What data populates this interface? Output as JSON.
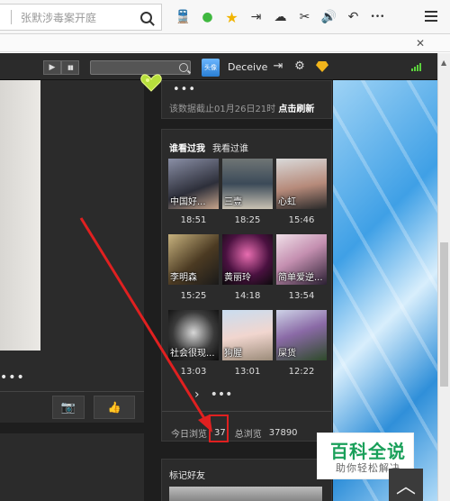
{
  "browser": {
    "search_text": "张默涉毒案开庭",
    "icons": [
      "search-icon",
      "train-icon",
      "chat-icon",
      "star-icon",
      "exit-icon",
      "cloud-icon",
      "scissors-icon",
      "speaker-icon",
      "undo-icon",
      "more-icon",
      "menu-icon"
    ],
    "icon_glyphs": [
      "🚆",
      "●",
      "★",
      "⇥",
      "☁",
      "✂",
      "🔊",
      "↶",
      "•••"
    ],
    "close_glyph": "✕"
  },
  "site_nav": {
    "play_glyph": "▶",
    "chart_glyph": "▮▮",
    "avatar_text": "头像",
    "username": "Deceive",
    "logout_glyph": "⇥",
    "gear_glyph": "⚙",
    "accent_gem": "#f2b51b"
  },
  "post": {
    "more": "•••",
    "camera_glyph": "📷",
    "like_glyph": "👍"
  },
  "sidebar_top": {
    "dots": "•••",
    "note": "该数据截止01月26日21时",
    "refresh": "点击刷新"
  },
  "visitors": {
    "tab_visited_me": "谁看过我",
    "tab_i_visited": "我看过谁",
    "items": [
      {
        "name": "中国好...",
        "time": "18:51"
      },
      {
        "name": "三壹",
        "time": "18:25"
      },
      {
        "name": "心虹",
        "time": "15:46"
      },
      {
        "name": "李明森",
        "time": "15:25"
      },
      {
        "name": "黄丽玲",
        "time": "14:18"
      },
      {
        "name": "简单爱逆...",
        "time": "13:54"
      },
      {
        "name": "社会很现...",
        "time": "13:03"
      },
      {
        "name": "狗腥",
        "time": "13:01"
      },
      {
        "name": "屎货",
        "time": "12:22"
      }
    ],
    "pager_next": "›",
    "pager_more": "•••",
    "today_label": "今日浏览",
    "today_value": "37",
    "total_label": "总浏览",
    "total_value": "37890"
  },
  "marked": {
    "title": "标记好友"
  },
  "watermark": {
    "big": "百科全说",
    "small": "助你轻松解决"
  },
  "back_to_top": "︿"
}
